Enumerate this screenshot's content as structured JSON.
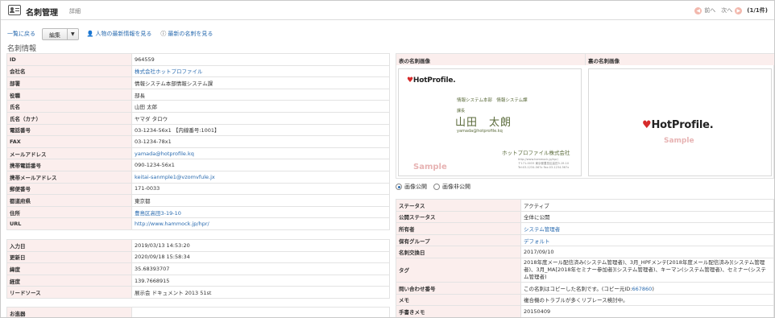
{
  "header": {
    "title": "名刺管理",
    "subtitle": "詳細",
    "prev_label": "前へ",
    "next_label": "次へ",
    "count": "(1/1件)"
  },
  "actions": {
    "back": "一覧に戻る",
    "edit": "編集",
    "person_latest": "人物の最新情報を見る",
    "card_latest": "最新の名刺を見る"
  },
  "section_title": "名刺情報",
  "left_table_1": [
    {
      "key": "ID",
      "value": "964559",
      "link": false
    },
    {
      "key": "会社名",
      "value": "株式会社ホットプロファイル",
      "link": true
    },
    {
      "key": "部署",
      "value": "情報システム本部情報システム課",
      "link": false
    },
    {
      "key": "役職",
      "value": "部長",
      "link": false
    },
    {
      "key": "氏名",
      "value": "山田 太郎",
      "link": false
    },
    {
      "key": "氏名（カナ）",
      "value": "ヤマダ タロウ",
      "link": false
    },
    {
      "key": "電話番号",
      "value": "03-1234-56x1 【内線番号:1001】",
      "link": false
    },
    {
      "key": "FAX",
      "value": "03-1234-78x1",
      "link": false
    },
    {
      "key": "メールアドレス",
      "value": "yamada@hotprofile.kq",
      "link": true
    },
    {
      "key": "携帯電話番号",
      "value": "090-1234-56x1",
      "link": false
    },
    {
      "key": "携帯メールアドレス",
      "value": "keitai-sanmple1@vzomvfule.jx",
      "link": true
    },
    {
      "key": "郵便番号",
      "value": "171-0033",
      "link": false
    },
    {
      "key": "都道府県",
      "value": "東京都",
      "link": false
    },
    {
      "key": "住所",
      "value": "豊島区高田3-19-10",
      "link": true
    },
    {
      "key": "URL",
      "value": "http://www.hammock.jp/hpr/",
      "link": true
    }
  ],
  "left_table_2": [
    {
      "key": "入力日",
      "value": "2019/03/13 14:53:20",
      "link": false
    },
    {
      "key": "更新日",
      "value": "2020/09/18 15:58:34",
      "link": false
    },
    {
      "key": "緯度",
      "value": "35.68393707",
      "link": false
    },
    {
      "key": "経度",
      "value": "139.7668915",
      "link": false
    },
    {
      "key": "リードソース",
      "value": "展示会 ドキュメント 2013 51st",
      "link": false
    }
  ],
  "left_table_3": [
    {
      "key": "お進器",
      "value": "",
      "link": false
    }
  ],
  "images": {
    "front_label": "表の名刺画像",
    "back_label": "裏の名刺画像",
    "logo_text": "HotProfile.",
    "sample_text": "Sample",
    "card_dept": "情報システム本部　情報システム課",
    "card_role": "課長",
    "card_name": "山田　太朗",
    "card_mail": "yamada@hotprofile.kq",
    "card_company": "ホットプロファイル株式会社",
    "card_addr_1": "http://www.hammock.jp/hpr/",
    "card_addr_2": "〒171-0033 東京都豊島区高田3-19-10",
    "card_addr_3": "Tel:03-1234-567x  Fax:03-1234-567x"
  },
  "visibility": {
    "public_label": "画像公開",
    "private_label": "画像非公開"
  },
  "right_table": [
    {
      "key": "ステータス",
      "value": "アクティブ",
      "link": false
    },
    {
      "key": "公開ステータス",
      "value": "全体に公開",
      "link": false
    },
    {
      "key": "所有者",
      "value": "システム管理者",
      "link": true
    },
    {
      "key": "保有グループ",
      "value": "デフォルト",
      "link": true
    },
    {
      "key": "名刺交換日",
      "value": "2017/09/10",
      "link": false
    },
    {
      "key": "タグ",
      "value": "2018年度メール配信済み(システム管理者)、3月_HPFメンテ[2018年度メール配信済み](システム管理者)、3月_MA[2018年セミナー参加者](システム管理者)、キーマン(システム管理者)、セミナー(システム管理者)",
      "link": false,
      "wrap": true
    },
    {
      "key": "問い合わせ番号",
      "value": "この名刺はコピーした名刺です。(コピー元ID:",
      "link": false,
      "suffix": "667860",
      "close": ")"
    },
    {
      "key": "メモ",
      "value": "複合機のトラブルが多くリプレース検討中。",
      "link": false
    },
    {
      "key": "手書きメモ",
      "value": "20150409",
      "link": false
    }
  ]
}
